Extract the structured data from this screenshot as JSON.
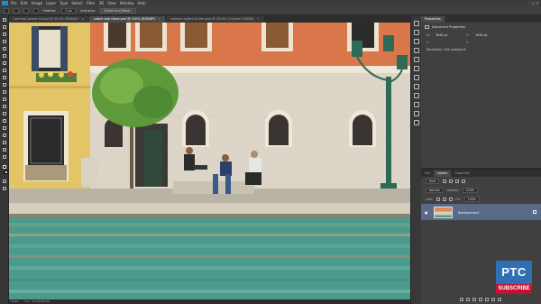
{
  "menubar": {
    "items": [
      "File",
      "Edit",
      "Image",
      "Layer",
      "Type",
      "Select",
      "Filter",
      "3D",
      "View",
      "Window",
      "Help"
    ]
  },
  "options_bar": {
    "feather_label": "Feather:",
    "feather_value": "0 px",
    "antialias_label": "Anti-alias",
    "select_mask_label": "Select and Mask..."
  },
  "doc_tabs": [
    {
      "label": "contrast-aware fill.psd @ 33.3% (RGB/8)*",
      "active": false
    },
    {
      "label": "patch tool clone.psd @ 100% (RGB/8*)",
      "active": true
    },
    {
      "label": "remove object sticker.psd @ 25.6% (Original, RGB/8)",
      "active": false
    }
  ],
  "properties": {
    "tabs": [
      "Properties"
    ],
    "title": "Document Properties",
    "w_label": "W:",
    "w_value": "3840 px",
    "h_label": "H:",
    "h_value": "1828 px",
    "x_label": "X:",
    "y_label": "Y:",
    "resolution": "Resolution: 300 pixels/inch"
  },
  "layers": {
    "tabs": [
      "Chi",
      "Layers",
      "Channels"
    ],
    "kind_label": "Kind",
    "blend_mode": "Normal",
    "opacity_label": "Opacity:",
    "opacity_value": "100%",
    "lock_label": "Lock:",
    "fill_label": "Fill:",
    "fill_value": "100%",
    "layer_name": "Background"
  },
  "status_bar": {
    "zoom": "100%",
    "doc_size": "Doc: 15.0M/30.0M"
  },
  "logo": {
    "top": "PTC",
    "bottom": "SUBSCRIBE",
    "top_color": "#2f6fb3",
    "bottom_color": "#c8102e"
  },
  "colors": {
    "photoshop_blue": "#1f8bd8",
    "selected_layer": "#596a89",
    "ui_dark": "#323232"
  }
}
